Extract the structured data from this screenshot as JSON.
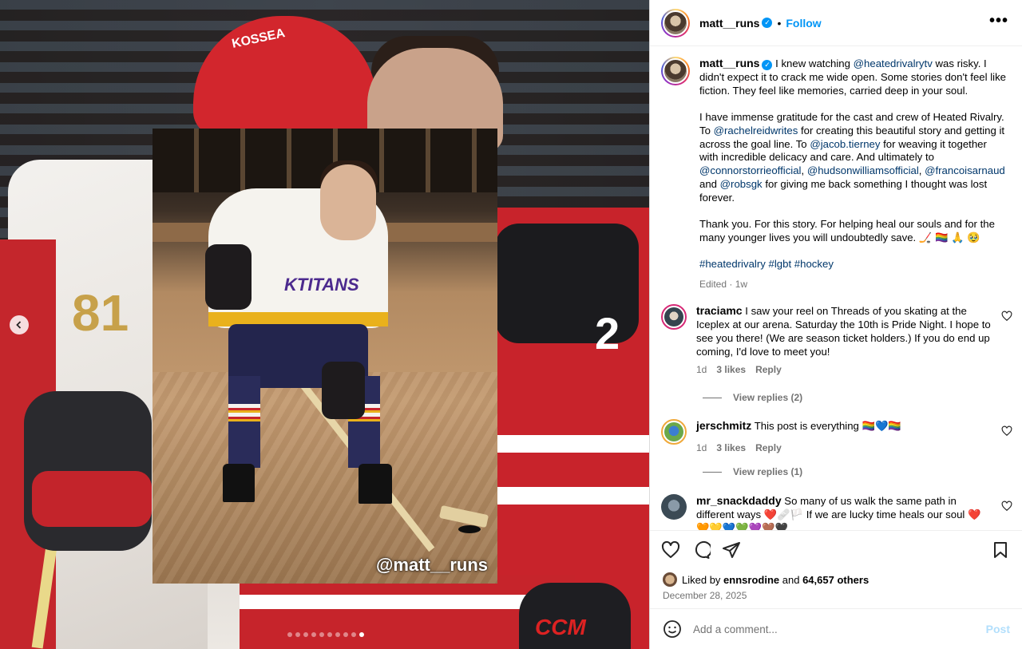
{
  "post": {
    "username": "matt__runs",
    "follow_label": "Follow",
    "more_label": "•••",
    "watermark": "@matt__runs",
    "slide_count": 10,
    "active_slide": 10,
    "background_texts": {
      "helmet": "KOSSEA",
      "left_number": "81",
      "right_number": "2",
      "brand": "CCM"
    },
    "inset_texts": {
      "jersey_logo": "KTITANS"
    }
  },
  "caption": {
    "username": "matt__runs",
    "p1_a": "I knew watching ",
    "p1_m1": "@heatedrivalrytv",
    "p1_b": " was risky. I didn't expect it to crack me wide open. Some stories don't feel like fiction. They feel like memories, carried deep in your soul.",
    "p2_a": "I have immense gratitude for the cast and crew of Heated Rivalry. To ",
    "p2_m1": "@rachelreidwrites",
    "p2_b": " for creating this beautiful story and getting it across the goal line. To ",
    "p2_m2": "@jacob.tierney",
    "p2_c": " for weaving it together with incredible delicacy and care. And ultimately to ",
    "p2_m3": "@connorstorrieofficial",
    "p2_d": ", ",
    "p2_m4": "@hudsonwilliamsofficial",
    "p2_e": ", ",
    "p2_m5": "@francoisarnaud",
    "p2_f": " and ",
    "p2_m6": "@robsgk",
    "p2_g": " for giving me back something I thought was lost forever.",
    "p3": "Thank you. For this story. For helping heal our souls and for the many younger lives you will undoubtedly save. 🏒 🏳️‍🌈 🙏 🥹",
    "tag1": "#heatedrivalry",
    "tag2": "#lgbt",
    "tag3": "#hockey",
    "edited": "Edited",
    "age": "1w"
  },
  "comments": [
    {
      "username": "traciamc",
      "text": "I saw your reel on Threads of you skating at the Iceplex at our arena. Saturday the 10th is Pride Night. I hope to see you there! (We are season ticket holders.) If you do end up coming, I'd love to meet you!",
      "age": "1d",
      "likes": "3 likes",
      "reply": "Reply",
      "view_replies": "View replies (2)"
    },
    {
      "username": "jerschmitz",
      "text": "This post is everything 🏳️‍🌈💙🏳️‍🌈",
      "age": "1d",
      "likes": "3 likes",
      "reply": "Reply",
      "view_replies": "View replies (1)"
    },
    {
      "username": "mr_snackdaddy",
      "text": "So many of us walk the same path in different ways ❤️🩹🏳️ If we are lucky time heals our soul ❤️🧡💛💙💚💜🤎🖤"
    }
  ],
  "footer": {
    "liked_prefix": "Liked by ",
    "liked_user": "ennsrodine",
    "liked_mid": " and ",
    "liked_count": "64,657 others",
    "date": "December 28, 2025",
    "comment_placeholder": "Add a comment...",
    "post_label": "Post"
  },
  "colors": {
    "link": "#0095f6",
    "mention": "#00376b",
    "muted": "#737373"
  }
}
